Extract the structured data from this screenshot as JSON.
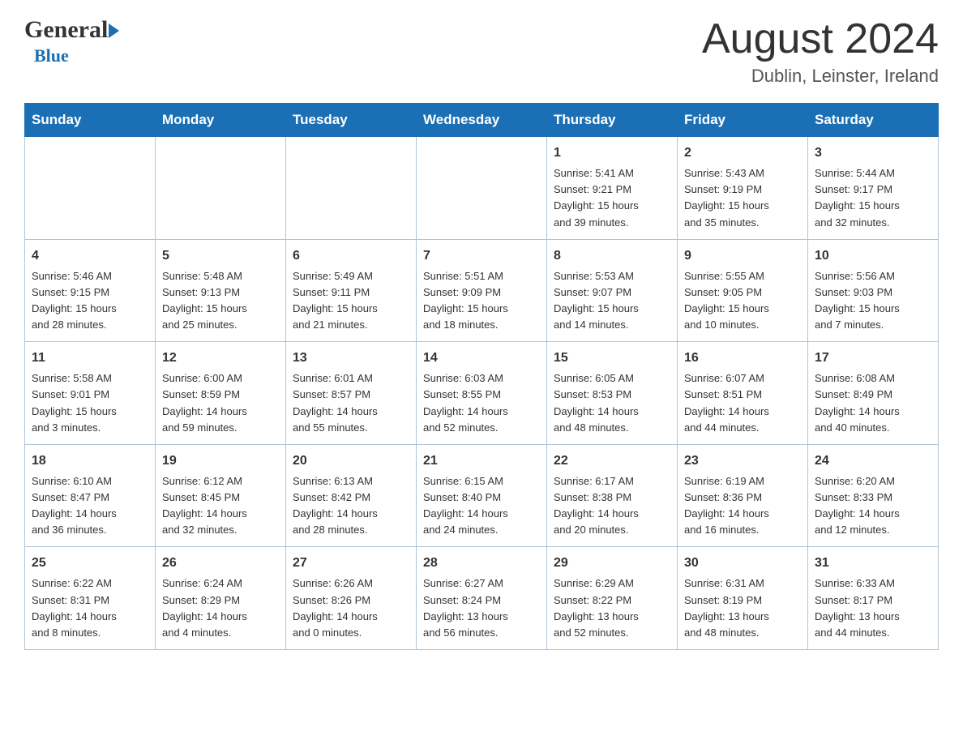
{
  "header": {
    "logo_general": "General",
    "logo_blue": "Blue",
    "month_title": "August 2024",
    "location": "Dublin, Leinster, Ireland"
  },
  "weekdays": [
    "Sunday",
    "Monday",
    "Tuesday",
    "Wednesday",
    "Thursday",
    "Friday",
    "Saturday"
  ],
  "weeks": [
    [
      {
        "day": "",
        "info": ""
      },
      {
        "day": "",
        "info": ""
      },
      {
        "day": "",
        "info": ""
      },
      {
        "day": "",
        "info": ""
      },
      {
        "day": "1",
        "info": "Sunrise: 5:41 AM\nSunset: 9:21 PM\nDaylight: 15 hours\nand 39 minutes."
      },
      {
        "day": "2",
        "info": "Sunrise: 5:43 AM\nSunset: 9:19 PM\nDaylight: 15 hours\nand 35 minutes."
      },
      {
        "day": "3",
        "info": "Sunrise: 5:44 AM\nSunset: 9:17 PM\nDaylight: 15 hours\nand 32 minutes."
      }
    ],
    [
      {
        "day": "4",
        "info": "Sunrise: 5:46 AM\nSunset: 9:15 PM\nDaylight: 15 hours\nand 28 minutes."
      },
      {
        "day": "5",
        "info": "Sunrise: 5:48 AM\nSunset: 9:13 PM\nDaylight: 15 hours\nand 25 minutes."
      },
      {
        "day": "6",
        "info": "Sunrise: 5:49 AM\nSunset: 9:11 PM\nDaylight: 15 hours\nand 21 minutes."
      },
      {
        "day": "7",
        "info": "Sunrise: 5:51 AM\nSunset: 9:09 PM\nDaylight: 15 hours\nand 18 minutes."
      },
      {
        "day": "8",
        "info": "Sunrise: 5:53 AM\nSunset: 9:07 PM\nDaylight: 15 hours\nand 14 minutes."
      },
      {
        "day": "9",
        "info": "Sunrise: 5:55 AM\nSunset: 9:05 PM\nDaylight: 15 hours\nand 10 minutes."
      },
      {
        "day": "10",
        "info": "Sunrise: 5:56 AM\nSunset: 9:03 PM\nDaylight: 15 hours\nand 7 minutes."
      }
    ],
    [
      {
        "day": "11",
        "info": "Sunrise: 5:58 AM\nSunset: 9:01 PM\nDaylight: 15 hours\nand 3 minutes."
      },
      {
        "day": "12",
        "info": "Sunrise: 6:00 AM\nSunset: 8:59 PM\nDaylight: 14 hours\nand 59 minutes."
      },
      {
        "day": "13",
        "info": "Sunrise: 6:01 AM\nSunset: 8:57 PM\nDaylight: 14 hours\nand 55 minutes."
      },
      {
        "day": "14",
        "info": "Sunrise: 6:03 AM\nSunset: 8:55 PM\nDaylight: 14 hours\nand 52 minutes."
      },
      {
        "day": "15",
        "info": "Sunrise: 6:05 AM\nSunset: 8:53 PM\nDaylight: 14 hours\nand 48 minutes."
      },
      {
        "day": "16",
        "info": "Sunrise: 6:07 AM\nSunset: 8:51 PM\nDaylight: 14 hours\nand 44 minutes."
      },
      {
        "day": "17",
        "info": "Sunrise: 6:08 AM\nSunset: 8:49 PM\nDaylight: 14 hours\nand 40 minutes."
      }
    ],
    [
      {
        "day": "18",
        "info": "Sunrise: 6:10 AM\nSunset: 8:47 PM\nDaylight: 14 hours\nand 36 minutes."
      },
      {
        "day": "19",
        "info": "Sunrise: 6:12 AM\nSunset: 8:45 PM\nDaylight: 14 hours\nand 32 minutes."
      },
      {
        "day": "20",
        "info": "Sunrise: 6:13 AM\nSunset: 8:42 PM\nDaylight: 14 hours\nand 28 minutes."
      },
      {
        "day": "21",
        "info": "Sunrise: 6:15 AM\nSunset: 8:40 PM\nDaylight: 14 hours\nand 24 minutes."
      },
      {
        "day": "22",
        "info": "Sunrise: 6:17 AM\nSunset: 8:38 PM\nDaylight: 14 hours\nand 20 minutes."
      },
      {
        "day": "23",
        "info": "Sunrise: 6:19 AM\nSunset: 8:36 PM\nDaylight: 14 hours\nand 16 minutes."
      },
      {
        "day": "24",
        "info": "Sunrise: 6:20 AM\nSunset: 8:33 PM\nDaylight: 14 hours\nand 12 minutes."
      }
    ],
    [
      {
        "day": "25",
        "info": "Sunrise: 6:22 AM\nSunset: 8:31 PM\nDaylight: 14 hours\nand 8 minutes."
      },
      {
        "day": "26",
        "info": "Sunrise: 6:24 AM\nSunset: 8:29 PM\nDaylight: 14 hours\nand 4 minutes."
      },
      {
        "day": "27",
        "info": "Sunrise: 6:26 AM\nSunset: 8:26 PM\nDaylight: 14 hours\nand 0 minutes."
      },
      {
        "day": "28",
        "info": "Sunrise: 6:27 AM\nSunset: 8:24 PM\nDaylight: 13 hours\nand 56 minutes."
      },
      {
        "day": "29",
        "info": "Sunrise: 6:29 AM\nSunset: 8:22 PM\nDaylight: 13 hours\nand 52 minutes."
      },
      {
        "day": "30",
        "info": "Sunrise: 6:31 AM\nSunset: 8:19 PM\nDaylight: 13 hours\nand 48 minutes."
      },
      {
        "day": "31",
        "info": "Sunrise: 6:33 AM\nSunset: 8:17 PM\nDaylight: 13 hours\nand 44 minutes."
      }
    ]
  ]
}
